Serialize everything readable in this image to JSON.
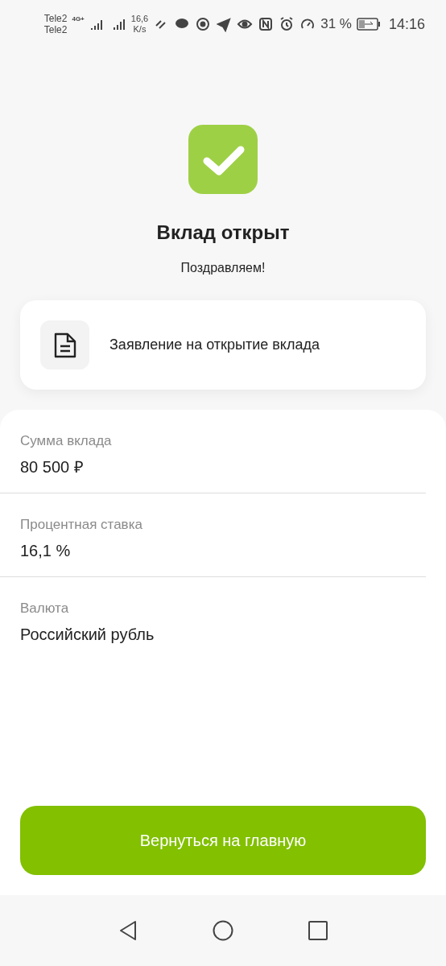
{
  "status_bar": {
    "carrier_1": "Tele2",
    "carrier_2": "Tele2",
    "network": "4G+",
    "speed_value": "16,6",
    "speed_unit": "K/s",
    "battery": "31 %",
    "time": "14:16"
  },
  "title": "Вклад открыт",
  "subtitle": "Поздравляем!",
  "document": {
    "label": "Заявление на открытие вклада"
  },
  "details": [
    {
      "label": "Сумма вклада",
      "value": "80 500 ₽"
    },
    {
      "label": "Процентная ставка",
      "value": "16,1 %"
    },
    {
      "label": "Валюта",
      "value": "Российский рубль"
    }
  ],
  "button": "Вернуться на главную"
}
